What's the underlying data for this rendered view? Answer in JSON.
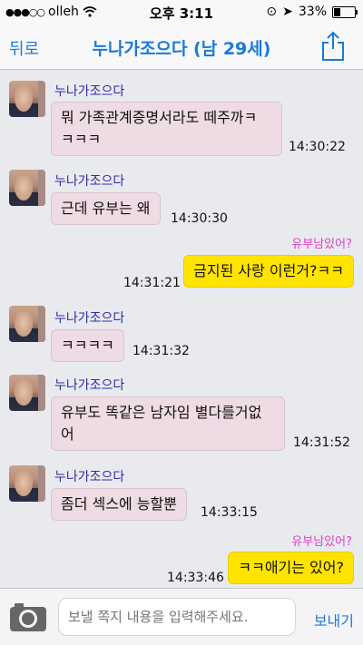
{
  "status": {
    "carrier": "olleh",
    "time": "오후 3:11",
    "battery": "33%",
    "battery_level": 0.33
  },
  "nav": {
    "back_label": "뒤로",
    "title": "누나가조으다 (남 29세)"
  },
  "messages": [
    {
      "kind": "in",
      "sender": "누나가조으다",
      "text": "뭐 가족관계증명서라도 떼주까ㅋ\nㅋㅋㅋ",
      "time": "14:30:22"
    },
    {
      "kind": "in",
      "sender": "누나가조으다",
      "text": "근데 유부는 왜",
      "time": "14:30:30"
    },
    {
      "kind": "out",
      "flag": "유부남있어?",
      "text": "금지된 사랑 이런거?ㅋㅋ",
      "time": "14:31:21"
    },
    {
      "kind": "in",
      "sender": "누나가조으다",
      "text": "ㅋㅋㅋㅋ",
      "time": "14:31:32"
    },
    {
      "kind": "in",
      "sender": "누나가조으다",
      "text": "유부도 똑같은 남자임 별다를거없\n어",
      "time": "14:31:52"
    },
    {
      "kind": "in",
      "sender": "누나가조으다",
      "text": "좀더 섹스에 능할뿐",
      "time": "14:33:15"
    },
    {
      "kind": "out",
      "flag": "유부남있어?",
      "text": "ㅋㅋ애기는 있어?",
      "time": "14:33:46"
    }
  ],
  "composer": {
    "placeholder": "보낼 쪽지 내용을 입력해주세요.",
    "send_label": "보내기"
  },
  "colors": {
    "accent": "#1a7ad9",
    "incoming_bubble": "#eedbe4",
    "outgoing_bubble": "#ffe400",
    "sender": "#2c2ca8",
    "flag": "#e040c8"
  }
}
